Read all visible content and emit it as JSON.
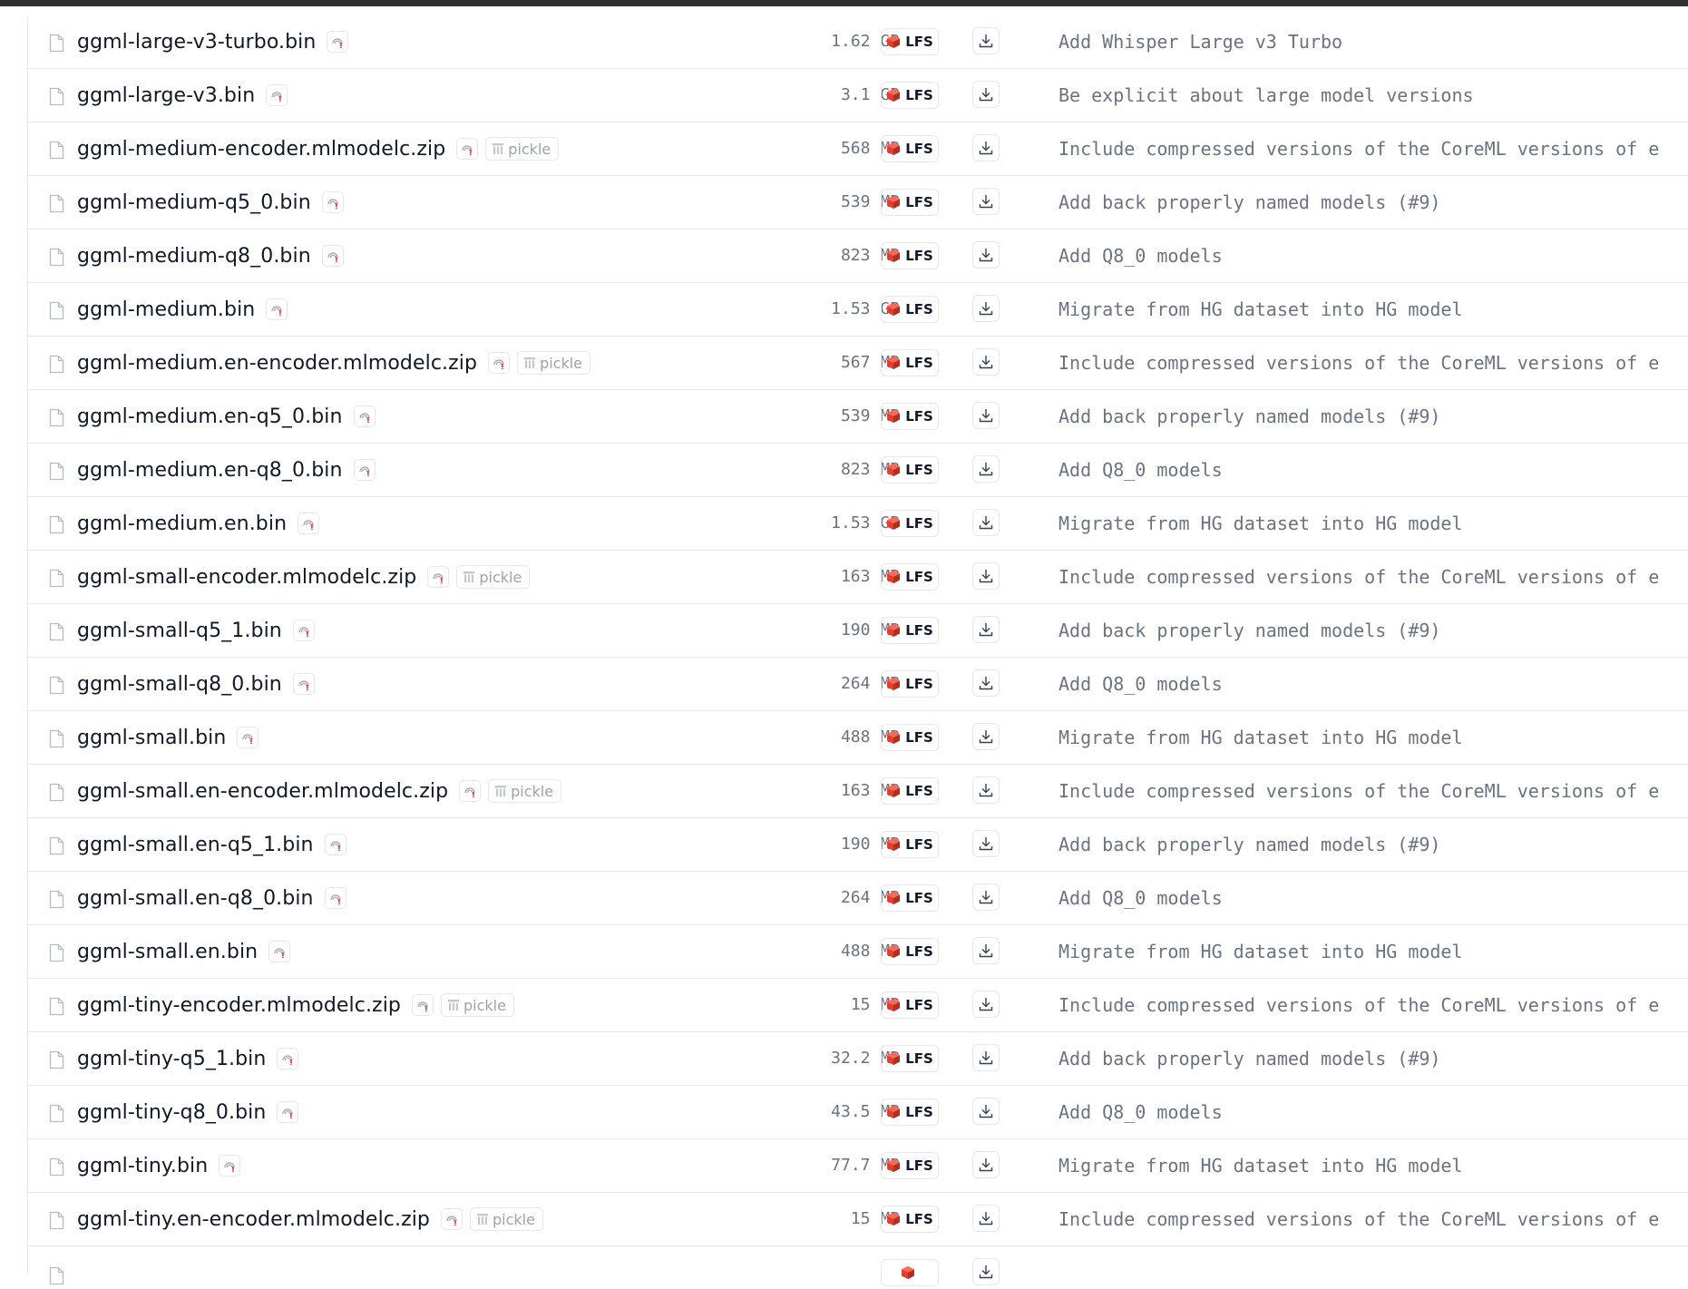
{
  "files": [
    {
      "name": "ggml-large-v3-turbo.bin",
      "pickle": false,
      "size": "1.62 GB",
      "lfs": "LFS",
      "commit": "Add Whisper Large v3 Turbo"
    },
    {
      "name": "ggml-large-v3.bin",
      "pickle": false,
      "size": "3.1 GB",
      "lfs": "LFS",
      "commit": "Be explicit about large model versions"
    },
    {
      "name": "ggml-medium-encoder.mlmodelc.zip",
      "pickle": true,
      "pickle_label": "pickle",
      "size": "568 MB",
      "lfs": "LFS",
      "commit": "Include compressed versions of the CoreML versions of e"
    },
    {
      "name": "ggml-medium-q5_0.bin",
      "pickle": false,
      "size": "539 MB",
      "lfs": "LFS",
      "commit": "Add back properly named models (#9)"
    },
    {
      "name": "ggml-medium-q8_0.bin",
      "pickle": false,
      "size": "823 MB",
      "lfs": "LFS",
      "commit": "Add Q8_0 models"
    },
    {
      "name": "ggml-medium.bin",
      "pickle": false,
      "size": "1.53 GB",
      "lfs": "LFS",
      "commit": "Migrate from HG dataset into HG model"
    },
    {
      "name": "ggml-medium.en-encoder.mlmodelc.zip",
      "pickle": true,
      "pickle_label": "pickle",
      "size": "567 MB",
      "lfs": "LFS",
      "commit": "Include compressed versions of the CoreML versions of e"
    },
    {
      "name": "ggml-medium.en-q5_0.bin",
      "pickle": false,
      "size": "539 MB",
      "lfs": "LFS",
      "commit": "Add back properly named models (#9)"
    },
    {
      "name": "ggml-medium.en-q8_0.bin",
      "pickle": false,
      "size": "823 MB",
      "lfs": "LFS",
      "commit": "Add Q8_0 models"
    },
    {
      "name": "ggml-medium.en.bin",
      "pickle": false,
      "size": "1.53 GB",
      "lfs": "LFS",
      "commit": "Migrate from HG dataset into HG model"
    },
    {
      "name": "ggml-small-encoder.mlmodelc.zip",
      "pickle": true,
      "pickle_label": "pickle",
      "size": "163 MB",
      "lfs": "LFS",
      "commit": "Include compressed versions of the CoreML versions of e"
    },
    {
      "name": "ggml-small-q5_1.bin",
      "pickle": false,
      "size": "190 MB",
      "lfs": "LFS",
      "commit": "Add back properly named models (#9)"
    },
    {
      "name": "ggml-small-q8_0.bin",
      "pickle": false,
      "size": "264 MB",
      "lfs": "LFS",
      "commit": "Add Q8_0 models"
    },
    {
      "name": "ggml-small.bin",
      "pickle": false,
      "size": "488 MB",
      "lfs": "LFS",
      "commit": "Migrate from HG dataset into HG model"
    },
    {
      "name": "ggml-small.en-encoder.mlmodelc.zip",
      "pickle": true,
      "pickle_label": "pickle",
      "size": "163 MB",
      "lfs": "LFS",
      "commit": "Include compressed versions of the CoreML versions of e"
    },
    {
      "name": "ggml-small.en-q5_1.bin",
      "pickle": false,
      "size": "190 MB",
      "lfs": "LFS",
      "commit": "Add back properly named models (#9)"
    },
    {
      "name": "ggml-small.en-q8_0.bin",
      "pickle": false,
      "size": "264 MB",
      "lfs": "LFS",
      "commit": "Add Q8_0 models"
    },
    {
      "name": "ggml-small.en.bin",
      "pickle": false,
      "size": "488 MB",
      "lfs": "LFS",
      "commit": "Migrate from HG dataset into HG model"
    },
    {
      "name": "ggml-tiny-encoder.mlmodelc.zip",
      "pickle": true,
      "pickle_label": "pickle",
      "size": "15 MB",
      "lfs": "LFS",
      "commit": "Include compressed versions of the CoreML versions of e"
    },
    {
      "name": "ggml-tiny-q5_1.bin",
      "pickle": false,
      "size": "32.2 MB",
      "lfs": "LFS",
      "commit": "Add back properly named models (#9)"
    },
    {
      "name": "ggml-tiny-q8_0.bin",
      "pickle": false,
      "size": "43.5 MB",
      "lfs": "LFS",
      "commit": "Add Q8_0 models"
    },
    {
      "name": "ggml-tiny.bin",
      "pickle": false,
      "size": "77.7 MB",
      "lfs": "LFS",
      "commit": "Migrate from HG dataset into HG model"
    },
    {
      "name": "ggml-tiny.en-encoder.mlmodelc.zip",
      "pickle": true,
      "pickle_label": "pickle",
      "size": "15 MB",
      "lfs": "LFS",
      "commit": "Include compressed versions of the CoreML versions of e"
    },
    {
      "name": "",
      "pickle": false,
      "size": "",
      "lfs": "",
      "commit": ""
    }
  ],
  "icons": {
    "file": "file-icon",
    "security": "security-scan-icon",
    "pickle": "pickle-icon",
    "lfs": "lfs-icon",
    "download": "download-icon"
  },
  "colors": {
    "lfs_red": "#e23e2b",
    "text_muted": "#6b7280",
    "border": "#e5e7eb"
  }
}
